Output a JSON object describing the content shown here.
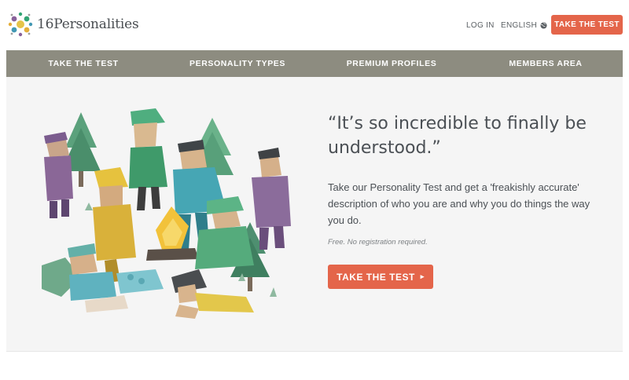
{
  "header": {
    "logo_text": "16Personalities",
    "login": "LOG IN",
    "language": "ENGLISH",
    "cta": "TAKE THE TEST"
  },
  "nav": {
    "items": [
      {
        "label": "TAKE THE TEST"
      },
      {
        "label": "PERSONALITY TYPES"
      },
      {
        "label": "PREMIUM PROFILES"
      },
      {
        "label": "MEMBERS AREA"
      }
    ]
  },
  "hero": {
    "quote": "“It’s so incredible to finally be understood.”",
    "description": "Take our Personality Test and get a 'freakishly accurate' description of who you are and why you do things the way you do.",
    "note": "Free. No registration required.",
    "cta": "TAKE THE TEST",
    "cta_icon": "chevron-right-icon"
  },
  "icons": {
    "logo": "logo-mark-icon",
    "language": "globe-icon"
  },
  "colors": {
    "accent": "#e4654a",
    "nav_bg": "#8d8c80",
    "hero_bg": "#f5f5f5"
  }
}
